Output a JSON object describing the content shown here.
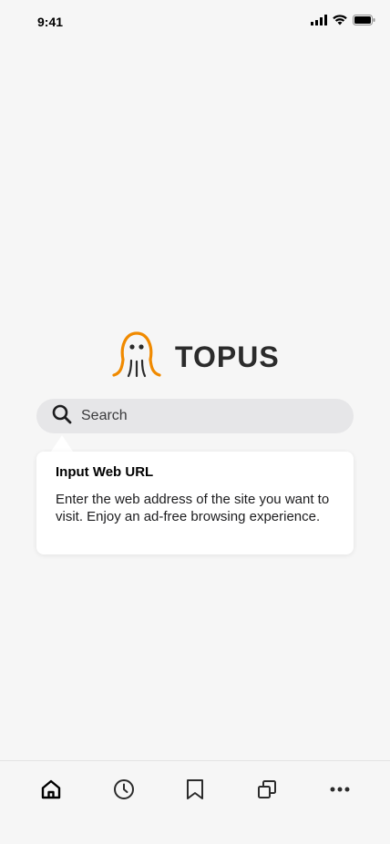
{
  "status_bar": {
    "time": "9:41"
  },
  "brand": {
    "name": "TOPUS",
    "color": "#f08a00"
  },
  "search": {
    "placeholder": "Search"
  },
  "tooltip": {
    "title": "Input Web URL",
    "body": "Enter the web address of the site you want to visit. Enjoy an ad-free browsing experience."
  },
  "tab_bar": {
    "items": [
      {
        "icon": "home-icon",
        "active": true
      },
      {
        "icon": "history-icon",
        "active": false
      },
      {
        "icon": "bookmark-icon",
        "active": false
      },
      {
        "icon": "tabs-icon",
        "active": false
      },
      {
        "icon": "more-icon",
        "active": false
      }
    ]
  }
}
